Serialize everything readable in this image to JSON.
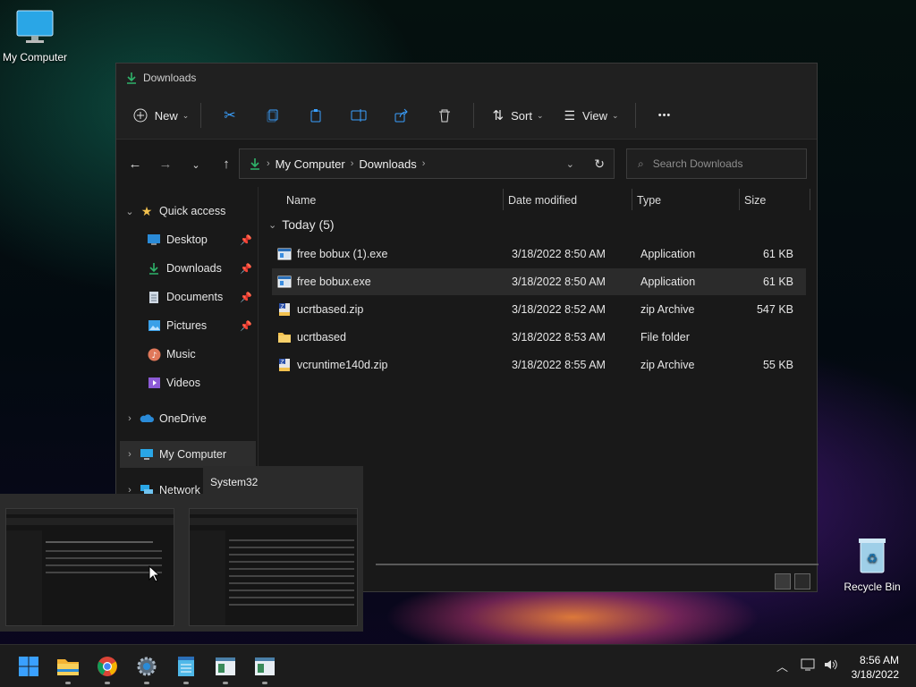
{
  "desktop": {
    "my_computer_label": "My Computer",
    "recycle_bin_label": "Recycle Bin"
  },
  "window": {
    "title": "Downloads",
    "toolbar": {
      "new_label": "New",
      "sort_label": "Sort",
      "view_label": "View",
      "more_label": "•••"
    },
    "address": {
      "root": "My Computer",
      "folder": "Downloads"
    },
    "search": {
      "placeholder": "Search Downloads"
    },
    "nav": {
      "quick_access": "Quick access",
      "items": [
        {
          "label": "Desktop",
          "pinned": true
        },
        {
          "label": "Downloads",
          "pinned": true
        },
        {
          "label": "Documents",
          "pinned": true
        },
        {
          "label": "Pictures",
          "pinned": true
        },
        {
          "label": "Music",
          "pinned": false
        },
        {
          "label": "Videos",
          "pinned": false
        }
      ],
      "onedrive": "OneDrive",
      "my_computer": "My Computer",
      "network": "Network"
    },
    "columns": {
      "name": "Name",
      "date": "Date modified",
      "type": "Type",
      "size": "Size"
    },
    "group_label": "Today (5)",
    "files": [
      {
        "name": "free bobux (1).exe",
        "date": "3/18/2022 8:50 AM",
        "type": "Application",
        "size": "61 KB",
        "icon": "app-icon"
      },
      {
        "name": "free bobux.exe",
        "date": "3/18/2022 8:50 AM",
        "type": "Application",
        "size": "61 KB",
        "icon": "app-icon"
      },
      {
        "name": "ucrtbased.zip",
        "date": "3/18/2022 8:52 AM",
        "type": "zip Archive",
        "size": "547 KB",
        "icon": "zip-icon"
      },
      {
        "name": "ucrtbased",
        "date": "3/18/2022 8:53 AM",
        "type": "File folder",
        "size": "",
        "icon": "folder-icon"
      },
      {
        "name": "vcruntime140d.zip",
        "date": "3/18/2022 8:55 AM",
        "type": "zip Archive",
        "size": "55 KB",
        "icon": "zip-icon"
      }
    ]
  },
  "thumbnail_popup": {
    "title": "System32"
  },
  "taskbar": {
    "time": "8:56 AM",
    "date": "3/18/2022"
  },
  "colors": {
    "accent_green": "#2fb36a",
    "folder_yellow": "#f2c14e",
    "window_bg": "#191919"
  }
}
